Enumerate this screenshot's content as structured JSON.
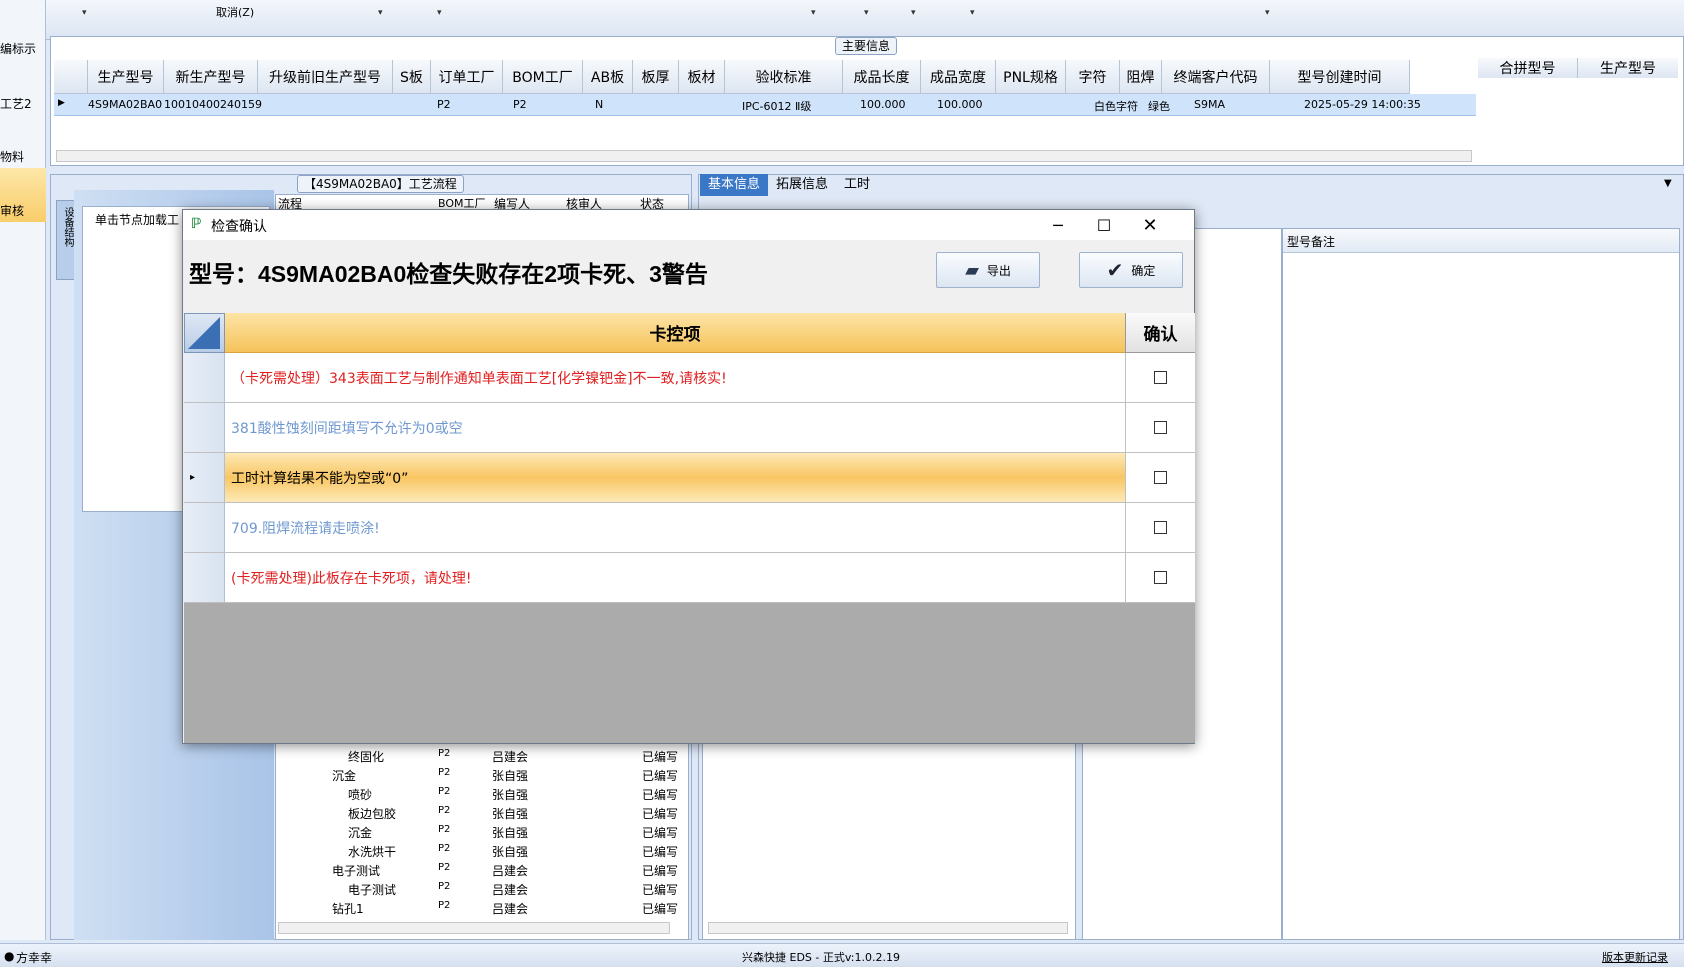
{
  "toolbar": {
    "cancel_label": "取消(Z)"
  },
  "left_nav": {
    "items": [
      "编标示",
      "",
      "工艺2",
      "",
      "物料",
      "审核"
    ]
  },
  "main_info": {
    "section_label": "主要信息",
    "columns": [
      "生产型号",
      "新生产型号",
      "升级前旧生产型号",
      "S板",
      "订单工厂",
      "BOM工厂",
      "AB板",
      "板厚",
      "板材",
      "验收标准",
      "成品长度",
      "成品宽度",
      "PNL规格",
      "字符",
      "阻焊",
      "终端客户代码",
      "型号创建时间"
    ],
    "row": {
      "model": "4S9MA02BA0",
      "new_model": "10010400240159",
      "order_factory": "P2",
      "bom_factory": "P2",
      "ab": "N",
      "standard": "IPC-6012 Ⅱ级",
      "length": "100.000",
      "width": "100.000",
      "char": "白色字符",
      "mask": "绿色",
      "customer": "S9MA",
      "created": "2025-05-29 14:00:35"
    },
    "merge_columns": [
      "合拼型号",
      "生产型号"
    ]
  },
  "process": {
    "section_label": "【4S9MA02BA0】工艺流程",
    "hint": "单击节点加载工",
    "vtab": "设备结构",
    "columns": [
      "流程",
      "BOM工厂",
      "编写人",
      "核审人",
      "状态"
    ],
    "rows": [
      {
        "name": "终固化",
        "factory": "P2",
        "writer": "吕建会",
        "status": "已编写"
      },
      {
        "name": "沉金",
        "factory": "P2",
        "writer": "张自强",
        "status": "已编写"
      },
      {
        "name": "喷砂",
        "factory": "P2",
        "writer": "张自强",
        "status": "已编写"
      },
      {
        "name": "板边包胶",
        "factory": "P2",
        "writer": "张自强",
        "status": "已编写"
      },
      {
        "name": "沉金",
        "factory": "P2",
        "writer": "张自强",
        "status": "已编写"
      },
      {
        "name": "水洗烘干",
        "factory": "P2",
        "writer": "张自强",
        "status": "已编写"
      },
      {
        "name": "电子测试",
        "factory": "P2",
        "writer": "吕建会",
        "status": "已编写"
      },
      {
        "name": "电子测试",
        "factory": "P2",
        "writer": "吕建会",
        "status": "已编写"
      },
      {
        "name": "钻孔1",
        "factory": "P2",
        "writer": "吕建会",
        "status": "已编写"
      }
    ]
  },
  "right_tabs": [
    "基本信息",
    "拓展信息",
    "工时"
  ],
  "remark_header": "型号备注",
  "status_bar": {
    "user": "方幸幸",
    "app": "兴森快捷 EDS - 正式v:1.0.2.19",
    "link": "版本更新记录"
  },
  "dialog": {
    "title": "检查确认",
    "headline": "型号：4S9MA02BA0检查失败存在2项卡死、3警告",
    "export_label": "导出",
    "ok_label": "确定",
    "col_item": "卡控项",
    "col_confirm": "确认",
    "rows": [
      {
        "text": "（卡死需处理）343表面工艺与制作通知单表面工艺[化学镍钯金]不一致,请核实!",
        "color": "#e02020"
      },
      {
        "text": "381酸性蚀刻间距填写不允许为0或空",
        "color": "#6f98d0"
      },
      {
        "text": "工时计算结果不能为空或“0”",
        "color": "#000000"
      },
      {
        "text": "709.阻焊流程请走喷涂!",
        "color": "#6f98d0"
      },
      {
        "text": "(卡死需处理)此板存在卡死项，请处理!",
        "color": "#e02020"
      }
    ]
  }
}
